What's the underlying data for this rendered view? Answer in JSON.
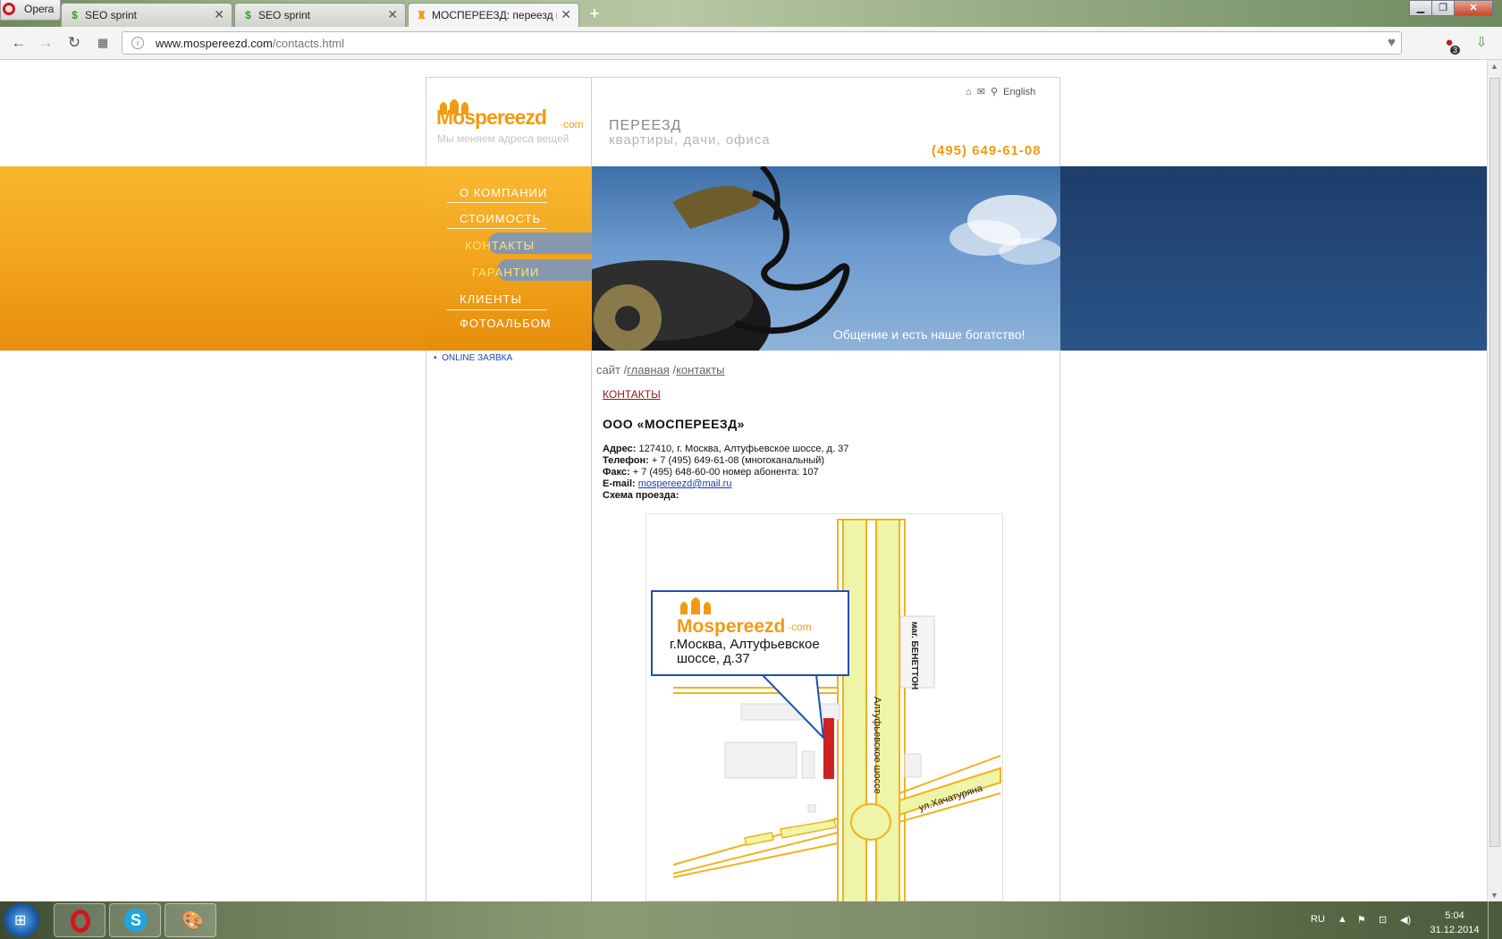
{
  "browser": {
    "menu_label": "Opera",
    "tabs": [
      {
        "label": "SEO sprint",
        "favicon": "dollar-icon"
      },
      {
        "label": "SEO sprint",
        "favicon": "dollar-icon"
      },
      {
        "label": "МОСПЕРЕЕЗД: переезд к",
        "favicon": "moscow-domes-icon"
      }
    ],
    "url_host": "www.mospereezd.com",
    "url_path": "/contacts.html",
    "notification_count": "3"
  },
  "header": {
    "logo_text": "Mospereezd",
    "logo_domain": "·com",
    "logo_tagline": "Мы меняем адреса вещей",
    "lang_link": "English",
    "title": "ПЕРЕЕЗД",
    "subtitle": "квартиры, дачи, офиса",
    "phone": "(495) 649-61-08"
  },
  "menu": {
    "items": [
      {
        "label": "О КОМПАНИИ"
      },
      {
        "label": "СТОИМОСТЬ"
      },
      {
        "label": "КОНТАКТЫ"
      },
      {
        "label": "ГАРАНТИИ"
      },
      {
        "label": "КЛИЕНТЫ"
      },
      {
        "label": "ФОТОАЛЬБОМ"
      }
    ],
    "online_link": "ONLINE ЗАЯВКА"
  },
  "banner": {
    "slogan": "Общение и есть наше богатство!"
  },
  "breadcrumb": {
    "root": "сайт",
    "sep": "/",
    "home": "главная",
    "current": "контакты"
  },
  "contacts": {
    "section_title": "КОНТАКТЫ",
    "company": "ООО «МОСПЕРЕЕЗД»",
    "address_label": "Адрес:",
    "address": "127410, г. Москва, Алтуфьевское шоссе, д. 37",
    "phone_label": "Телефон:",
    "phone": "+ 7 (495) 649-61-08 (многоканальный)",
    "fax_label": "Факс:",
    "fax": "+ 7 (495) 648-60-00 номер абонента: 107",
    "email_label": "E-mail:",
    "email": "mospereezd@mail.ru",
    "map_label": "Схема проезда:"
  },
  "map": {
    "logo_text": "Mospereezd",
    "logo_domain": "·com",
    "callout_line1": "г.Москва, Алтуфьевское",
    "callout_line2": "шоссе, д.37",
    "road_main": "Алтуфьевское шоссе",
    "road_side": "ул.Хачатуряна",
    "store": "маг. БЕНЕТТОН",
    "road_color": "#f2b21c",
    "road_fill": "#eef5a8",
    "marker_color": "#cc2222"
  },
  "taskbar": {
    "lang": "RU",
    "time": "5:04",
    "date": "31.12.2014"
  }
}
